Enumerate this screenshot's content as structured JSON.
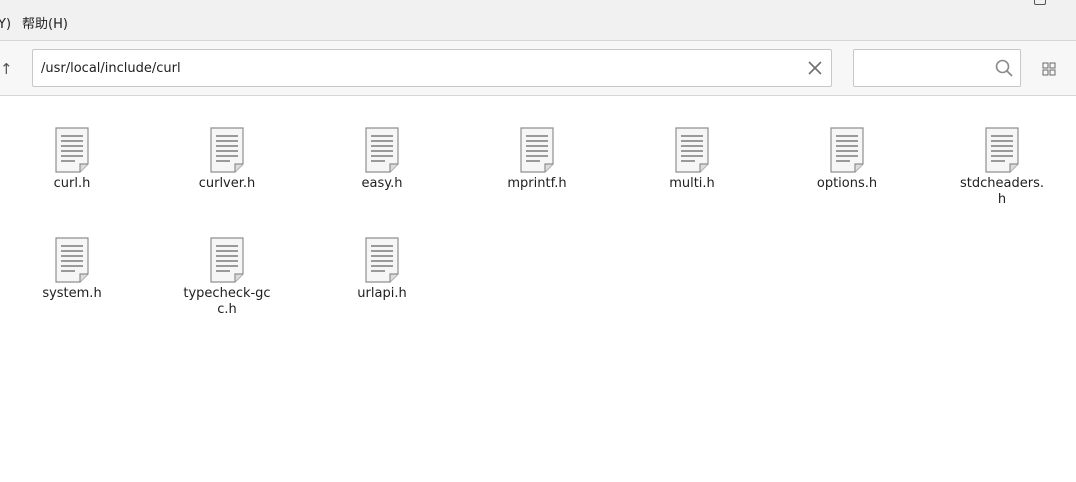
{
  "menubar": {
    "partial_item": "Y)",
    "help": "帮助(H)"
  },
  "toolbar": {
    "up_glyph": "↑",
    "path": "/usr/local/include/curl",
    "search_placeholder": ""
  },
  "files": [
    {
      "name": "curl.h",
      "icon": "text-file-icon"
    },
    {
      "name": "curlver.h",
      "icon": "text-file-icon"
    },
    {
      "name": "easy.h",
      "icon": "text-file-icon"
    },
    {
      "name": "mprintf.h",
      "icon": "text-file-icon"
    },
    {
      "name": "multi.h",
      "icon": "text-file-icon"
    },
    {
      "name": "options.h",
      "icon": "text-file-icon"
    },
    {
      "name": "stdcheaders.h",
      "icon": "text-file-icon"
    },
    {
      "name": "system.h",
      "icon": "text-file-icon"
    },
    {
      "name": "typecheck-gcc.h",
      "icon": "text-file-icon"
    },
    {
      "name": "urlapi.h",
      "icon": "text-file-icon"
    }
  ]
}
